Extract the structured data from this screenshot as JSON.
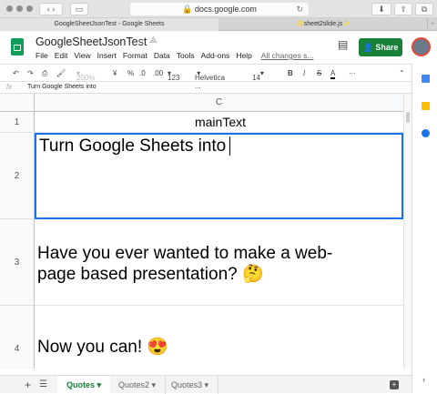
{
  "browser": {
    "url": "docs.google.com",
    "tabs": [
      {
        "label": "GoogleSheetJsonTest - Google Sheets"
      },
      {
        "label": "✨sheet2slide.js✨"
      }
    ]
  },
  "doc": {
    "title": "GoogleSheetJsonTest",
    "menu": [
      "File",
      "Edit",
      "View",
      "Insert",
      "Format",
      "Data",
      "Tools",
      "Add-ons",
      "Help"
    ],
    "save_status": "All changes s...",
    "share_label": "Share"
  },
  "toolbar": {
    "zoom": "200%",
    "currency": "¥",
    "percent": "%",
    "dec_less": ".0",
    "dec_more": ".00",
    "format": "123",
    "font": "Helvetica ...",
    "size": "14",
    "bold": "B",
    "italic": "I",
    "strike": "S",
    "textcolor": "A",
    "more": "···"
  },
  "formula": {
    "fx": "fx",
    "value": "Turn Google Sheets into"
  },
  "grid": {
    "column": "C",
    "rows": [
      {
        "num": "1",
        "text": "mainText"
      },
      {
        "num": "2",
        "text": "Turn Google Sheets into"
      },
      {
        "num": "3",
        "text": "Have you ever wanted to make a web-page based presentation? 🤔"
      },
      {
        "num": "4",
        "text": "Now you can! 😍"
      }
    ]
  },
  "sheets": [
    {
      "label": "Quotes"
    },
    {
      "label": "Quotes2"
    },
    {
      "label": "Quotes3"
    }
  ],
  "colors": {
    "accent": "#188038",
    "selection": "#1a73e8"
  }
}
